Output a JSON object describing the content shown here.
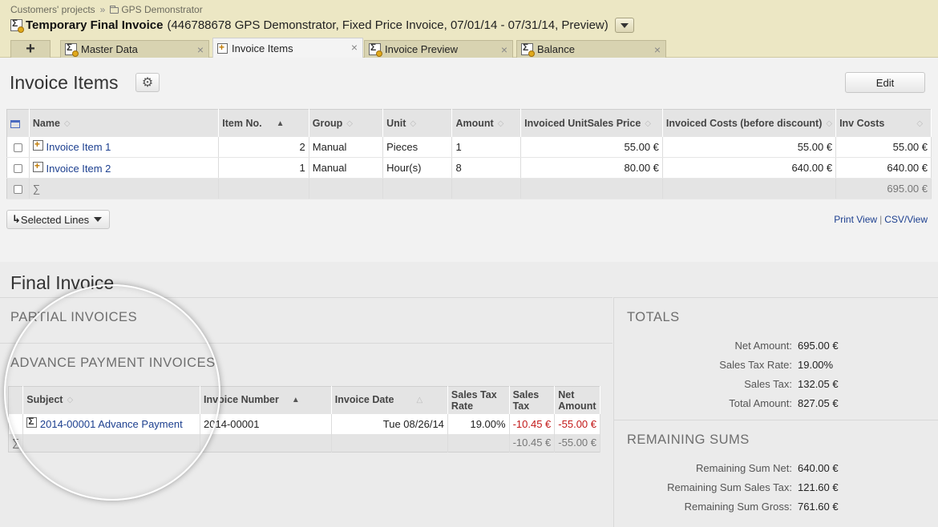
{
  "breadcrumb": {
    "root": "Customers' projects",
    "project": "GPS Demonstrator"
  },
  "header": {
    "title": "Temporary Final Invoice",
    "subtitle": "(446788678 GPS Demonstrator, Fixed Price Invoice, 07/01/14 - 07/31/14, Preview)"
  },
  "tabs": [
    {
      "label": "Master Data",
      "active": false
    },
    {
      "label": "Invoice Items",
      "active": true
    },
    {
      "label": "Invoice Preview",
      "active": false
    },
    {
      "label": "Balance",
      "active": false
    }
  ],
  "tab_add_label": "+",
  "page": {
    "title": "Invoice Items",
    "edit_label": "Edit"
  },
  "items_table": {
    "columns": [
      "Name",
      "Item No.",
      "Group",
      "Unit",
      "Amount",
      "Invoiced UnitSales Price",
      "Invoiced Costs (before discount)",
      "Inv Costs"
    ],
    "rows": [
      {
        "name": "Invoice Item 1",
        "item_no": "2",
        "group": "Manual",
        "unit": "Pieces",
        "amount": "1",
        "unit_price": "55.00 €",
        "costs": "55.00 €",
        "inv_costs": "55.00 €"
      },
      {
        "name": "Invoice Item 2",
        "item_no": "1",
        "group": "Manual",
        "unit": "Hour(s)",
        "amount": "8",
        "unit_price": "80.00 €",
        "costs": "640.00 €",
        "inv_costs": "640.00 €"
      }
    ],
    "sum_symbol": "∑",
    "sum_inv_costs": "695.00 €"
  },
  "selected_lines_label": "Selected Lines",
  "view_links": {
    "print": "Print View",
    "csv": "CSV/View"
  },
  "final_invoice": {
    "title": "Final Invoice",
    "partial_caption": "PARTIAL INVOICES",
    "advance_caption": "ADVANCE PAYMENT INVOICES",
    "advance_table": {
      "columns": [
        "Subject",
        "Invoice Number",
        "Invoice Date",
        "Sales Tax Rate",
        "Sales Tax",
        "Net Amount"
      ],
      "rows": [
        {
          "subject": "2014-00001 Advance Payment",
          "number": "2014-00001",
          "date": "Tue 08/26/14",
          "tax_rate": "19.00%",
          "tax": "-10.45 €",
          "net": "-55.00 €"
        }
      ],
      "sum_symbol": "∑",
      "sum_tax": "-10.45 €",
      "sum_net": "-55.00 €"
    },
    "totals_caption": "TOTALS",
    "totals": [
      {
        "label": "Net Amount:",
        "value": "695.00 €"
      },
      {
        "label": "Sales Tax Rate:",
        "value": "19.00%"
      },
      {
        "label": "Sales Tax:",
        "value": "132.05 €"
      },
      {
        "label": "Total Amount:",
        "value": "827.05 €"
      }
    ],
    "remaining_caption": "REMAINING SUMS",
    "remaining": [
      {
        "label": "Remaining Sum Net:",
        "value": "640.00 €"
      },
      {
        "label": "Remaining Sum Sales Tax:",
        "value": "121.60 €"
      },
      {
        "label": "Remaining Sum Gross:",
        "value": "761.60 €"
      }
    ]
  },
  "colors": {
    "header_bg": "#ece7c4",
    "link": "#1c3f8f",
    "negative": "#c21818"
  }
}
